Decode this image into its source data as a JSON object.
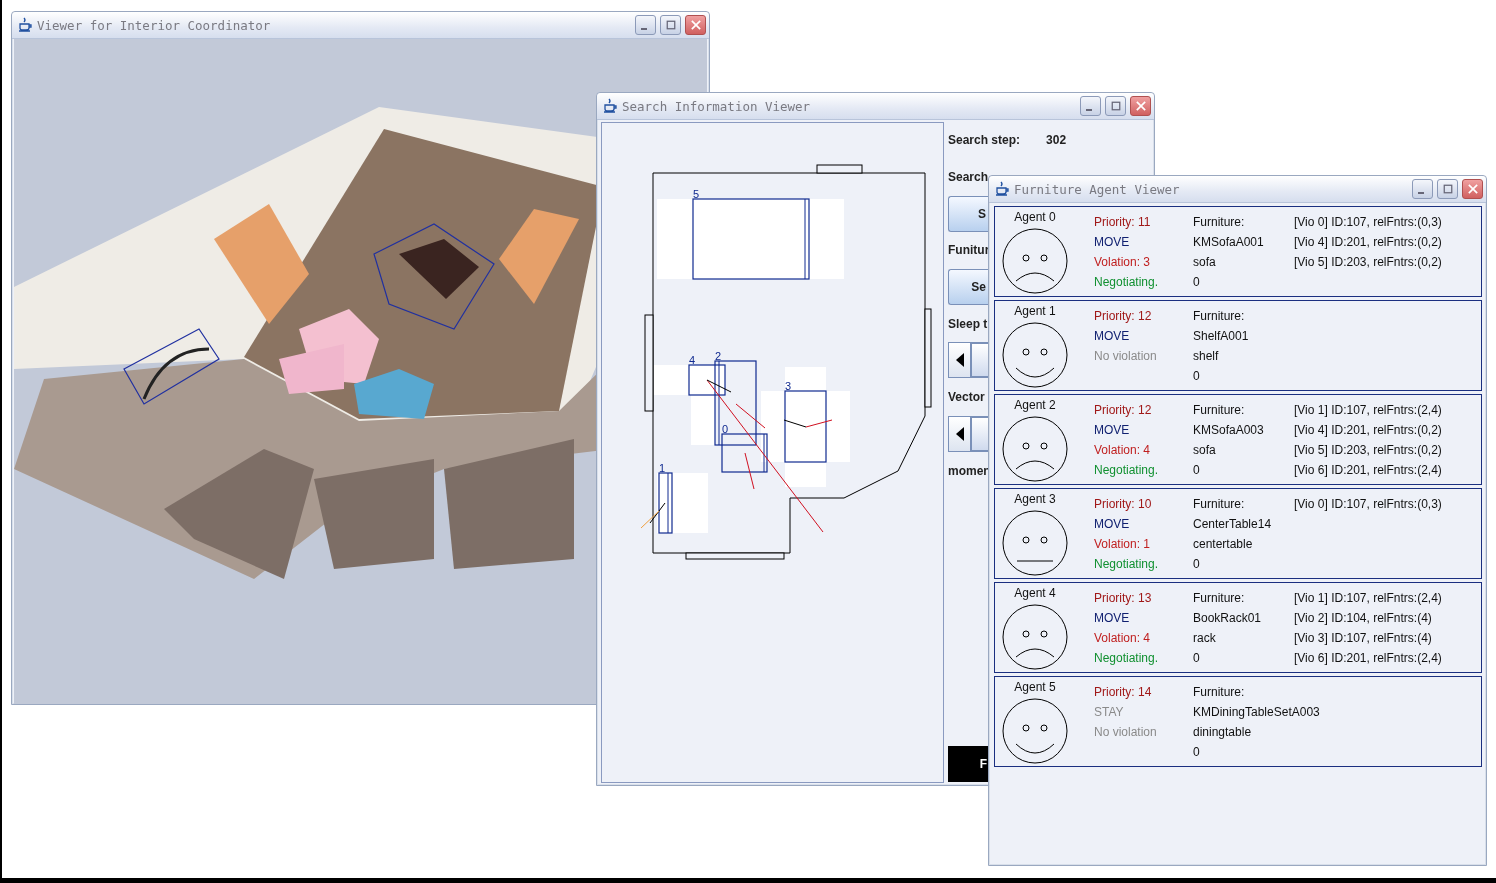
{
  "viewer_window": {
    "title": "Viewer for Interior Coordinator"
  },
  "search_window": {
    "title": "Search Information Viewer",
    "plan_labels": [
      "5",
      "4",
      "2",
      "0",
      "3",
      "1"
    ],
    "controls": [
      {
        "kind": "label",
        "text": "Search step:",
        "value": "302"
      },
      {
        "kind": "label",
        "text": "Search"
      },
      {
        "kind": "button",
        "text": "S"
      },
      {
        "kind": "label",
        "text": "Funitur"
      },
      {
        "kind": "button",
        "text": "Se"
      },
      {
        "kind": "label",
        "text": "Sleep t"
      },
      {
        "kind": "slider",
        "level": 0
      },
      {
        "kind": "label",
        "text": "Vector"
      },
      {
        "kind": "slider",
        "level": 0
      },
      {
        "kind": "label",
        "text": "momen"
      },
      {
        "kind": "dark-button",
        "text": "F"
      }
    ]
  },
  "agent_window": {
    "title": "Furniture Agent Viewer",
    "agents": [
      {
        "name": "Agent 0",
        "kind": "sad",
        "status": [
          {
            "kind": "priority",
            "text": "Priority: 11"
          },
          {
            "kind": "move",
            "text": "MOVE"
          },
          {
            "kind": "violation",
            "text": "Volation: 3"
          },
          {
            "kind": "negotiating",
            "text": "Negotiating."
          }
        ],
        "furniture": [
          "Furniture:",
          "KMSofaA001",
          "sofa",
          "0"
        ],
        "violations": [
          "[Vio 0] ID:107, relFntrs:(0,3)",
          "[Vio 4] ID:201, relFntrs:(0,2)",
          "[Vio 5] ID:203, relFntrs:(0,2)"
        ]
      },
      {
        "name": "Agent 1",
        "kind": "happy",
        "status": [
          {
            "kind": "priority",
            "text": "Priority: 12"
          },
          {
            "kind": "move",
            "text": "MOVE"
          },
          {
            "kind": "inactive",
            "text": "No violation"
          }
        ],
        "furniture": [
          "Furniture:",
          "ShelfA001",
          "shelf",
          "0"
        ]
      },
      {
        "name": "Agent 2",
        "kind": "sad",
        "status": [
          {
            "kind": "priority",
            "text": "Priority: 12"
          },
          {
            "kind": "move",
            "text": "MOVE"
          },
          {
            "kind": "violation",
            "text": "Volation: 4"
          },
          {
            "kind": "negotiating",
            "text": "Negotiating."
          }
        ],
        "furniture": [
          "Furniture:",
          "KMSofaA003",
          "sofa",
          "0"
        ],
        "violations": [
          "[Vio 1] ID:107, relFntrs:(2,4)",
          "[Vio 4] ID:201, relFntrs:(0,2)",
          "[Vio 5] ID:203, relFntrs:(0,2)",
          "[Vio 6] ID:201, relFntrs:(2,4)"
        ]
      },
      {
        "name": "Agent 3",
        "kind": "neutral",
        "status": [
          {
            "kind": "priority",
            "text": "Priority: 10"
          },
          {
            "kind": "move",
            "text": "MOVE"
          },
          {
            "kind": "violation",
            "text": "Volation: 1"
          },
          {
            "kind": "negotiating",
            "text": "Negotiating."
          }
        ],
        "furniture": [
          "Furniture:",
          "CenterTable14",
          "centertable",
          "0"
        ],
        "violations": [
          "[Vio 0] ID:107, relFntrs:(0,3)"
        ]
      },
      {
        "name": "Agent 4",
        "kind": "sad",
        "status": [
          {
            "kind": "priority",
            "text": "Priority: 13"
          },
          {
            "kind": "move",
            "text": "MOVE"
          },
          {
            "kind": "violation",
            "text": "Volation: 4"
          },
          {
            "kind": "negotiating",
            "text": "Negotiating."
          }
        ],
        "furniture": [
          "Furniture:",
          "BookRack01",
          "rack",
          "0"
        ],
        "violations": [
          "[Vio 1] ID:107, relFntrs:(2,4)",
          "[Vio 2] ID:104, relFntrs:(4)",
          "[Vio 3] ID:107, relFntrs:(4)",
          "[Vio 6] ID:201, relFntrs:(2,4)"
        ]
      },
      {
        "name": "Agent 5",
        "kind": "happy",
        "status": [
          {
            "kind": "priority",
            "text": "Priority: 14"
          },
          {
            "kind": "inactive",
            "text": "STAY"
          },
          {
            "kind": "inactive",
            "text": "No violation"
          }
        ],
        "furniture": [
          "Furniture:",
          "KMDiningTableSetA003",
          "diningtable",
          "0"
        ]
      }
    ]
  }
}
